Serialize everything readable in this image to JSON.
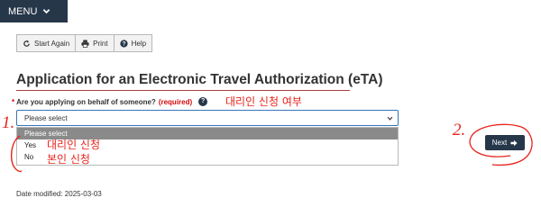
{
  "header": {
    "menu_label": "MENU"
  },
  "toolbar": {
    "start_again_label": "Start Again",
    "print_label": "Print",
    "help_label": "Help"
  },
  "page_title": "Application for an Electronic Travel Authorization (eTA)",
  "question": {
    "required_marker": "*",
    "text": "Are you applying on behalf of someone?",
    "required_label": "(required)",
    "help_icon_glyph": "?"
  },
  "select": {
    "value": "Please select",
    "options": [
      "Please select",
      "Yes",
      "No"
    ]
  },
  "next_label": "Next",
  "date_modified": "Date modified: 2025-03-03",
  "annotations": {
    "question_note": "대리인 신청 여부",
    "yes_note": "대리인 신청",
    "no_note": "본인 신청",
    "step_one": "1.",
    "step_two": "2."
  },
  "colors": {
    "brand_navy": "#26374a",
    "title_rule": "#af3c43",
    "required_red": "#d3080c",
    "annotation_red": "#e8231c",
    "select_border": "#3a74b7",
    "highlight_gray": "#8a8a8a"
  },
  "icons": [
    "chevron-down-icon",
    "refresh-icon",
    "print-icon",
    "question-icon",
    "arrow-right-icon"
  ]
}
